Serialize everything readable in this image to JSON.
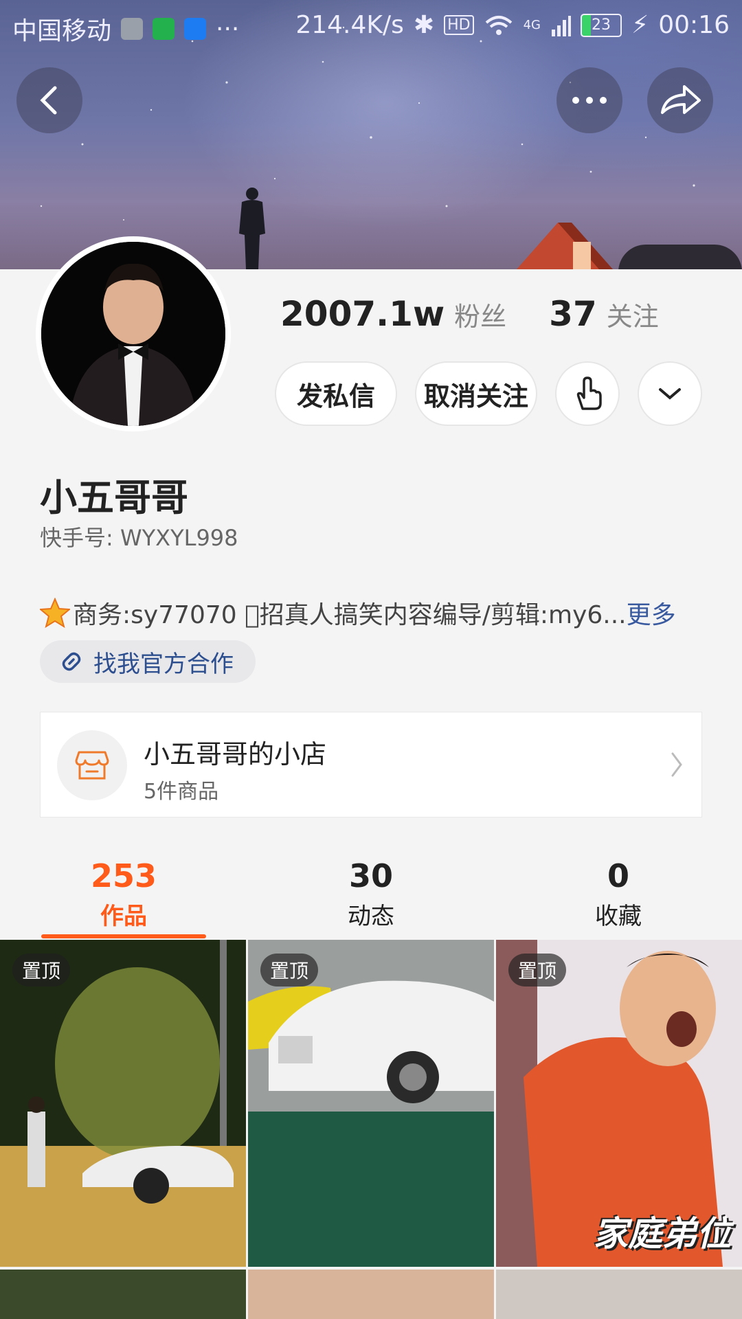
{
  "status_bar": {
    "carrier": "中国移动",
    "more": "···",
    "speed": "214.4K/s",
    "hd": "HD",
    "network": "4G",
    "battery": "23",
    "time": "00:16"
  },
  "profile": {
    "followers_count": "2007.1w",
    "followers_label": "粉丝",
    "following_count": "37",
    "following_label": "关注",
    "message_button": "发私信",
    "unfollow_button": "取消关注",
    "name": "小五哥哥",
    "kuaishou_id": "快手号: WYXYL998",
    "bio": "商务:sy77070 \u0000招真人搞笑内容编导/剪辑:my6...",
    "bio_more": "更多",
    "cooperation_label": "找我官方合作"
  },
  "shop": {
    "title": "小五哥哥的小店",
    "subtitle": "5件商品"
  },
  "tabs": [
    {
      "count": "253",
      "label": "作品"
    },
    {
      "count": "30",
      "label": "动态"
    },
    {
      "count": "0",
      "label": "收藏"
    }
  ],
  "videos": [
    {
      "badge": "置顶",
      "caption": ""
    },
    {
      "badge": "置顶",
      "caption": ""
    },
    {
      "badge": "置顶",
      "caption": "家庭弟位"
    }
  ],
  "colors": {
    "accent": "#fe5a1a",
    "link": "#3a5aa0"
  }
}
